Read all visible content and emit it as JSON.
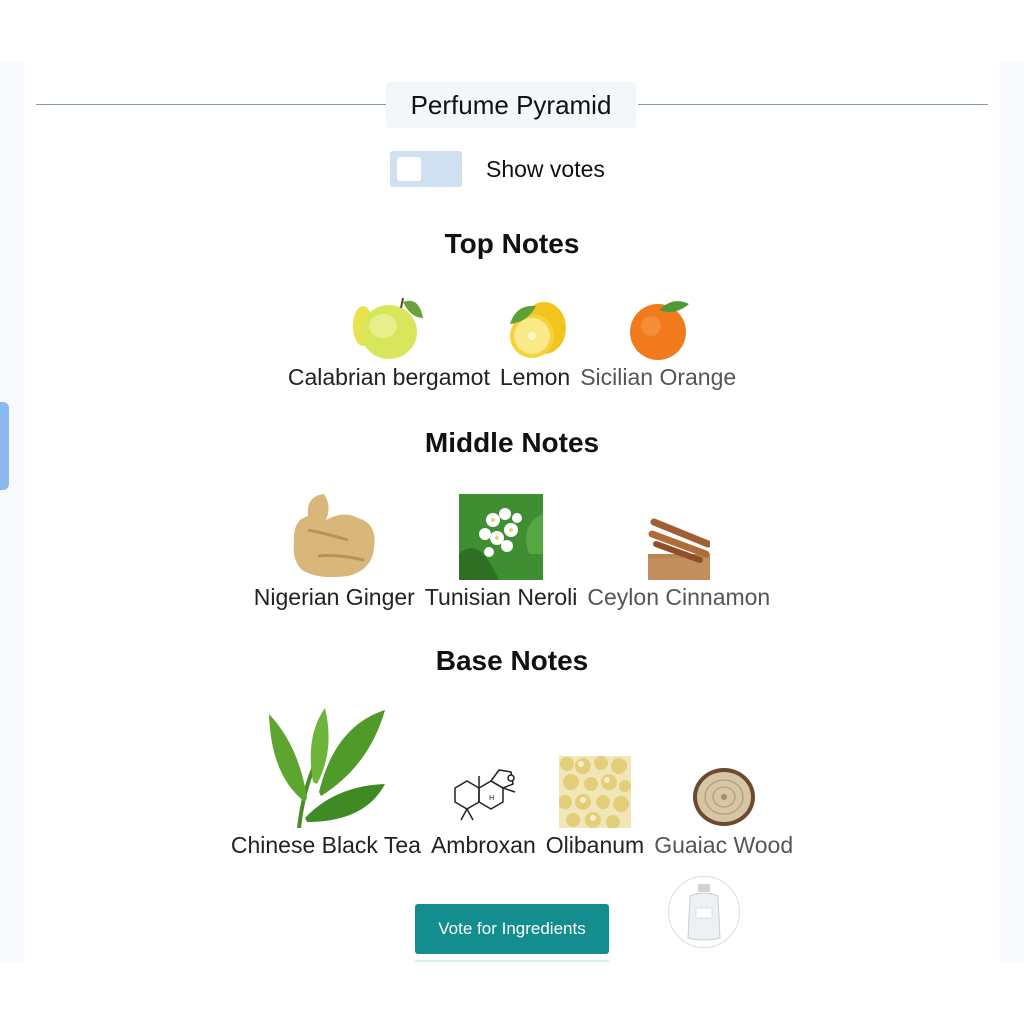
{
  "title": "Perfume Pyramid",
  "toggle": {
    "label": "Show votes",
    "checked": false
  },
  "sections": [
    {
      "title": "Top Notes",
      "notes": [
        {
          "label": "Calabrian bergamot",
          "icon": "bergamot-icon"
        },
        {
          "label": "Lemon",
          "icon": "lemon-icon"
        },
        {
          "label": "Sicilian Orange",
          "icon": "orange-icon"
        }
      ]
    },
    {
      "title": "Middle Notes",
      "notes": [
        {
          "label": "Nigerian Ginger",
          "icon": "ginger-icon"
        },
        {
          "label": "Tunisian Neroli",
          "icon": "neroli-icon"
        },
        {
          "label": "Ceylon Cinnamon",
          "icon": "cinnamon-icon"
        }
      ]
    },
    {
      "title": "Base Notes",
      "notes": [
        {
          "label": "Chinese Black Tea",
          "icon": "tea-leaves-icon"
        },
        {
          "label": "Ambroxan",
          "icon": "molecule-icon"
        },
        {
          "label": "Olibanum",
          "icon": "olibanum-icon"
        },
        {
          "label": "Guaiac Wood",
          "icon": "wood-slice-icon"
        }
      ]
    }
  ],
  "vote_button": "Vote for Ingredients",
  "colors": {
    "accent": "#138d8d",
    "toggle_track": "#cfe0f0",
    "rule": "#7f9bb3"
  }
}
